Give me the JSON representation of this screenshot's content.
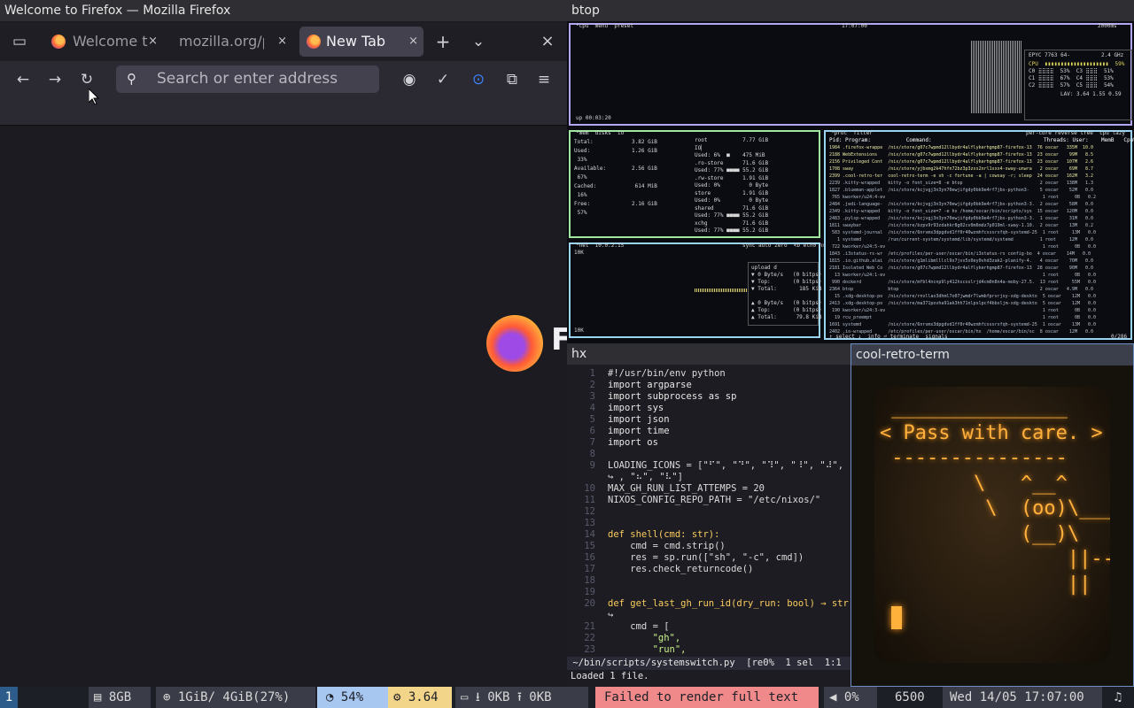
{
  "firefox": {
    "window_title": "Welcome to Firefox — Mozilla Firefox",
    "tabs": [
      {
        "label": "Welcome t",
        "close": "×"
      },
      {
        "label": "mozilla.org/pr",
        "close": "×"
      },
      {
        "label": "New Tab",
        "close": "×"
      }
    ],
    "new_tab": "+",
    "list_tabs": "⌄",
    "close_window": "×",
    "url_placeholder": "Search or enter address",
    "logo_text": "F"
  },
  "btop": {
    "title": "btop",
    "cpu_header": "¹cpu  menu  preset",
    "clock": "17:07:00",
    "refresh": "2000ms",
    "uptime": "up 00:03:20",
    "cpu_model": "EPYC 7763 64-",
    "cpu_freq": "2.4 GHz",
    "cpu_rows": [
      "CPU  ▮▮▮▮▮▮▮▮▮▮▮▮▮▮▮▮▮▮▮▮  59%",
      "C0 ⣿⣿⣿⣿  53%  C3 ⣿⣿⣿  51%",
      "C1 ⣿⣿⣿⣿  67%  C4 ⣿⣿⣿  53%",
      "C2 ⣿⣿⣿⣿  57%  C5 ⣿⣿⣿  54%"
    ],
    "lav": "LAV: 3.64 1.55 0.59",
    "mem_header": "²mem  disks  io",
    "mem_lines": [
      "Total:            3.82 GiB",
      "Used:             1.26 GiB",
      " 33%",
      "Available:        2.56 GiB",
      " 67%",
      "Cached:            614 MiB",
      " 16%",
      "Free:             2.16 GiB",
      " 57%"
    ],
    "disk_lines": [
      "root           7.77 GiB",
      "IO▏",
      "Used: 6%  ■    475 MiB",
      ".ro-store      71.6 GiB",
      "Used: 77% ■■■■ 55.2 GiB",
      ".rw-store      1.91 GiB",
      "Used: 0%         0 Byte",
      "store          1.91 GiB",
      "Used: 0%         0 Byte",
      "shared         71.6 GiB",
      "Used: 77% ■■■■ 55.2 GiB",
      "xchg           71.6 GiB",
      "Used: 77% ■■■■ 55.2 GiB"
    ],
    "net_header": "³net  10.0.2.15",
    "net_right": "sync auto zero  <b eth0 n>",
    "net_lines": [
      "upload d",
      "▼ 0 Byte/s   (0 bitps)",
      "▼ Top:       (0 bitps)",
      "▼ Total:       185 KiB",
      "",
      "▲ 0 Byte/s   (0 bitps)",
      "▲ Top:       (0 bitps)",
      "▲ Total:      79.8 KiB"
    ],
    "net_scale_top": "10K",
    "net_scale_bottom": "10K",
    "proc_header": "⁴proc  filter",
    "proc_right": "per-core reverse tree  cpu lazy",
    "proc_cols": "Pid: Program:           Command:                                   Threads: User:    MemB   Cpu%",
    "proc_rows": [
      "1984 .firefox-wrappe  /nix/store/g07c7wpmd12llbydr4alflykerhgmp87-firefox-13  76 oscar   335M  10.0",
      "2188 WebExtensions    /nix/store/g07c7wpmd12llbydr4alflykerhgmp87-firefox-13  23 oscar    99M   8.5",
      "2156 Privileged Cont  /nix/store/g07c7wpmd12llbydr4alflykerhgmp87-firefox-13  23 oscar   107M   2.6",
      "1708 sway             /nix/store/yjbxmg2k47hfn72bz3p3zxs2nrl1sxx4-sway-unwra   2 oscar    69M   8.7",
      "2399 .cool-retro-ter  cool-retro-term -e sh -c fortune -a | cowsay -r; sleep  24 oscar   162M   3.2",
      "2239 .kitty-wrapped   kitty -o font_size=8 -e btop                             2 oscar   138M   1.3",
      "1827 .blueman-applet  /nix/store/kcjvgj3n3yn70ewjifgdy0bk9e4rf7jbs-python3-    5 oscar    52M   0.0",
      " 765 kworker/u24:4-ev                                                           1 root      0B   0.2",
      "2484 .jedi-language-  /nix/store/kcjvgj3n3yn70ewjifgdy0bk9e4rf7jbs-python3-3.  2 oscar    58M   0.0",
      "2349 .kitty-wrapped   kitty -o font_size=7 -e hx /home/oscar/bin/scripts/sys  15 oscar   120M   0.0",
      "2483 .pylsp-wrapped   /nix/store/kcjvgj3n3yn70ewjifgdy0bk9e4rf7jbs-python3-3.  1 oscar    31M   0.0",
      "1811 swaybar          /nix/store/bzpv9r93zdahkr8g02cv0m6mdz7p019ml-sway-1.10.  2 oscar    13M   0.2",
      " 583 systemd-journal  /nix/store/6nrvmx3dpgdvd1ff0r40wzmhfcssxrxfqh-systemd-25  1 root     13M   0.0",
      "   1 systemd          /run/current-system/systemd/lib/systemd/systemd          1 root     12M   0.0",
      " 722 kworker/u24:5-ev                                                           1 root      0B   0.0",
      "1843 .i3status-rs-wr  /etc/profiles/per-user/oscar/bin/i3status-rs config-bo  4 oscar    14M   0.0",
      "1815 .io.github.alai  /nix/store/g1mlibmlllcl9x7jvx5x0ey0vhd3zak2-planify-4.   4 oscar    70M   0.0",
      "2181 Isolated Web Co  /nix/store/g07c7wpmd12llbydr4alflykerhgmp87-firefox-13  28 oscar    90M   0.0",
      "  13 kworker/u24:1-ev                                                           1 root      0B   0.0",
      " 990 dockerd          /nix/store/mfbl4ncnp9ly412hscxslrjd4cm0n8n4a-moby-27.5.  13 root     55M   0.0",
      "2364 btop             btop                                                     2 oscar   4.9M   0.0",
      "  15 .xdg-desktop-po  /nix/store/rnvllax3dhml7o07jwmdr7lwmbfprvrjxy-xdg-deskto  5 oscar    12M   0.0",
      "2413 .xdg-desktop-po  /nix/store/ma371povha91ak3hh71nlpslpcf4bbxljm-xdg-deskto  5 oscar    12M   0.0",
      " 190 kworker/u24:3-ev                                                           1 root      0B   0.0",
      "  19 rcu_preempt                                                                1 root      0B   0.0",
      "1691 systemd          /nix/store/6nrvmx3dpgdvd1ff0r40wzmhfcssxrxfqh-systemd-25  1 oscar    13M   0.0",
      "2402 .io-wrapped      /etc/profiles/per-user/oscar/bin/hx  /home/oscar/bin/sc  8 oscar    12M   0.0"
    ],
    "proc_footer": "↑ select ↓  info ⏎ terminate  signals",
    "proc_count": "0/286"
  },
  "hx": {
    "title": "hx",
    "lines": [
      {
        "n": "1",
        "code": "#!/usr/bin/env python",
        "cls": "pl"
      },
      {
        "n": "2",
        "code": "import argparse",
        "cls": "kwline"
      },
      {
        "n": "3",
        "code": "import subprocess as sp",
        "cls": "kwline"
      },
      {
        "n": "4",
        "code": "import sys",
        "cls": "kwline"
      },
      {
        "n": "5",
        "code": "import json",
        "cls": "kwline"
      },
      {
        "n": "6",
        "code": "import time",
        "cls": "kwline"
      },
      {
        "n": "7",
        "code": "import os",
        "cls": "kwline"
      },
      {
        "n": "8",
        "code": "",
        "cls": "pl"
      },
      {
        "n": "9",
        "code": "LOADING_ICONS = [\"⠋\", \"⠙\", \"⠹\", \"⠸\", \"⠼\", \"⠴\"",
        "cls": "pl"
      },
      {
        "n": "",
        "code": "↪ , \"⠦\", \"⠧\"]",
        "cls": "pl"
      },
      {
        "n": "10",
        "code": "MAX_GH_RUN_LIST_ATTEMPS = 20",
        "cls": "pl"
      },
      {
        "n": "11",
        "code": "NIXOS_CONFIG_REPO_PATH = \"/etc/nixos/\"",
        "cls": "pl"
      },
      {
        "n": "12",
        "code": "",
        "cls": "pl"
      },
      {
        "n": "13",
        "code": "",
        "cls": "pl"
      },
      {
        "n": "14",
        "code": "def shell(cmd: str):",
        "cls": "defline"
      },
      {
        "n": "15",
        "code": "    cmd = cmd.strip()",
        "cls": "pl"
      },
      {
        "n": "16",
        "code": "    res = sp.run([\"sh\", \"-c\", cmd])",
        "cls": "pl"
      },
      {
        "n": "17",
        "code": "    res.check_returncode()",
        "cls": "pl"
      },
      {
        "n": "18",
        "code": "",
        "cls": "pl"
      },
      {
        "n": "19",
        "code": "",
        "cls": "pl"
      },
      {
        "n": "20",
        "code": "def get_last_gh_run_id(dry_run: bool) → str:",
        "cls": "defline"
      },
      {
        "n": "",
        "code": "↪",
        "cls": "pl"
      },
      {
        "n": "21",
        "code": "    cmd = [",
        "cls": "pl"
      },
      {
        "n": "22",
        "code": "        \"gh\",",
        "cls": "str"
      },
      {
        "n": "23",
        "code": "        \"run\",",
        "cls": "str"
      }
    ],
    "status": " ~/bin/scripts/systemswitch.py  [re0%  1 sel  1:1",
    "message": "Loaded 1 file."
  },
  "crt": {
    "title": "cool-retro-term",
    "art": " _______________\n< Pass with care. >\n ---------------\n        \\   ^__^\n         \\  (oo)\\_______\n            (__)\\       )\\/\\\n                ||----w |\n                ||     ||"
  },
  "bar": {
    "workspace": "1",
    "ram": "8GB",
    "mem": "1GiB/ 4GiB(27%)",
    "cpu": "54%",
    "load": "3.64",
    "net_down": "0KB",
    "net_up": "0KB",
    "error": "Failed to render full text",
    "volume": "0%",
    "brightness": "6500",
    "datetime": "Wed 14/05 17:07:00"
  }
}
